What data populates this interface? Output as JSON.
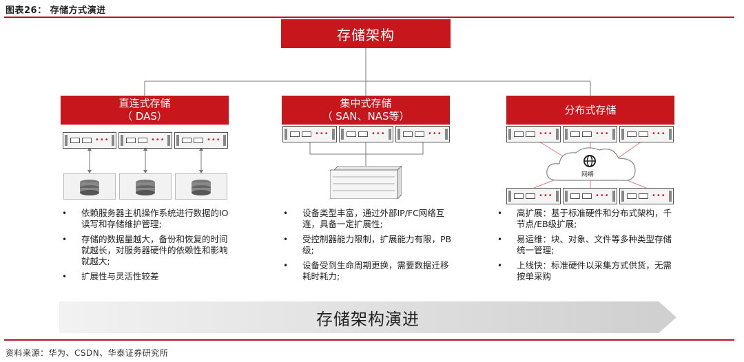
{
  "figure": {
    "title": "图表26：  存储方式演进",
    "source": "资料来源：华为、CSDN、华泰证券研究所"
  },
  "root": {
    "label": "存储架构"
  },
  "columns": [
    {
      "title": "直连式存储",
      "subtitle": "（ DAS）",
      "bullets": [
        "依赖服务器主机操作系统进行数据的IO读写和存储维护管理;",
        "存储的数据量越大，备份和恢复的时间就越长，对服务器硬件的依赖性和影响就越大;",
        "扩展性与灵活性较差"
      ]
    },
    {
      "title": "集中式存储",
      "subtitle": "（ SAN、NAS等）",
      "bullets": [
        "设备类型丰富，通过外部IP/FC网络互连，具备一定扩展性;",
        "受控制器能力限制，扩展能力有限，PB级;",
        "设备受到生命周期更换，需要数据迁移耗时耗力;"
      ]
    },
    {
      "title": "分布式存储",
      "subtitle": "",
      "network_label": "网络",
      "bullets": [
        "高扩展：基于标准硬件和分布式架构，千节点/EB级扩展;",
        "易运维：块、对象、文件等多种类型存储统一管理;",
        "上线快：标准硬件以采集方式供货，无需按单采购"
      ]
    }
  ],
  "evolution_arrow": {
    "label": "存储架构演进"
  },
  "colors": {
    "accent": "#c8161d",
    "rule": "#b7172c",
    "arrow_fill": "#d9d9d9",
    "led": "#d2232a"
  },
  "icons": [
    "server-icon",
    "disk-icon",
    "storage-array-icon",
    "cloud-icon",
    "globe-icon"
  ]
}
